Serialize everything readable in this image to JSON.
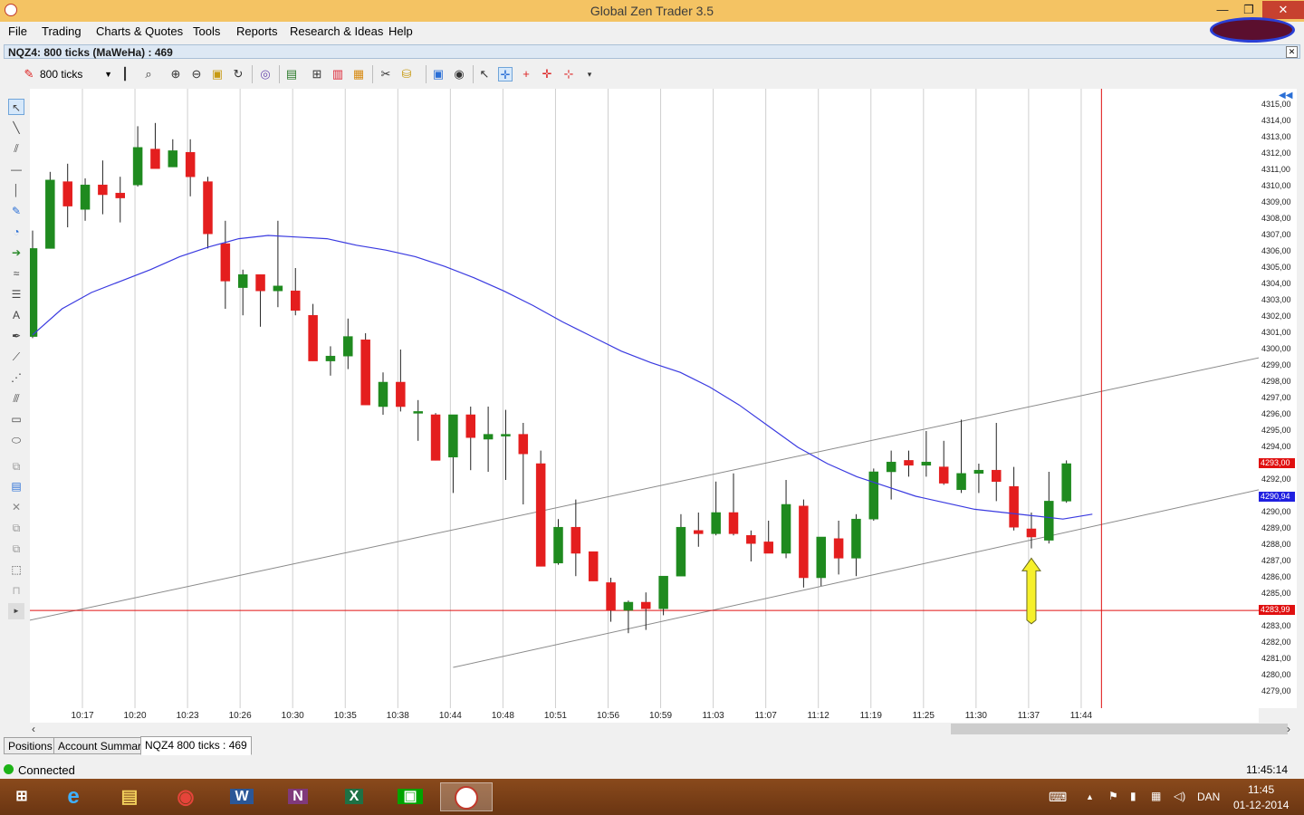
{
  "window": {
    "title": "Global Zen Trader 3.5",
    "controls": {
      "minimize": "—",
      "maximize": "❐",
      "close": "✕"
    }
  },
  "menu": [
    "File",
    "Trading",
    "Charts & Quotes",
    "Tools",
    "Reports",
    "Research & Ideas",
    "Help"
  ],
  "chart_window": {
    "title": "NQZ4: 800 ticks (MaWeHa) : 469"
  },
  "toolbar": {
    "ticks_value": "800 ticks"
  },
  "chart_data": {
    "type": "candlestick",
    "instrument": "NQZ4",
    "yaxis": {
      "min": 4278.0,
      "max": 4316.0,
      "tick_labels": [
        "4315,00",
        "4314,00",
        "4313,00",
        "4312,00",
        "4311,00",
        "4310,00",
        "4309,00",
        "4308,00",
        "4307,00",
        "4306,00",
        "4305,00",
        "4304,00",
        "4303,00",
        "4302,00",
        "4301,00",
        "4300,00",
        "4299,00",
        "4298,00",
        "4297,00",
        "4296,00",
        "4295,00",
        "4294,00",
        "4293,00",
        "4292,00",
        "4291,00",
        "4290,00",
        "4289,00",
        "4288,00",
        "4287,00",
        "4286,00",
        "4285,00",
        "4284,00",
        "4283,00",
        "4282,00",
        "4281,00",
        "4280,00",
        "4279,00"
      ],
      "price_badges": [
        {
          "label": "4293,00",
          "value": 4293.0,
          "color": "#e01010"
        },
        {
          "label": "4290,94",
          "value": 4290.94,
          "color": "#2020e0"
        },
        {
          "label": "4283,99",
          "value": 4283.99,
          "color": "#e01010"
        }
      ]
    },
    "xaxis": {
      "tick_labels": [
        "10:17",
        "10:20",
        "10:23",
        "10:26",
        "10:30",
        "10:35",
        "10:38",
        "10:44",
        "10:48",
        "10:51",
        "10:56",
        "10:59",
        "11:03",
        "11:07",
        "11:12",
        "11:19",
        "11:25",
        "11:30",
        "11:37",
        "11:44"
      ]
    },
    "candles": [
      {
        "o": 4300.8,
        "h": 4307.3,
        "l": 4300.7,
        "c": 4306.2
      },
      {
        "o": 4306.2,
        "h": 4310.9,
        "l": 4306.2,
        "c": 4310.4
      },
      {
        "o": 4310.3,
        "h": 4311.4,
        "l": 4307.5,
        "c": 4308.8
      },
      {
        "o": 4308.6,
        "h": 4310.5,
        "l": 4307.9,
        "c": 4310.1
      },
      {
        "o": 4310.1,
        "h": 4311.6,
        "l": 4308.3,
        "c": 4309.5
      },
      {
        "o": 4309.6,
        "h": 4310.6,
        "l": 4307.8,
        "c": 4309.3
      },
      {
        "o": 4310.1,
        "h": 4313.7,
        "l": 4310.0,
        "c": 4312.4
      },
      {
        "o": 4312.3,
        "h": 4313.9,
        "l": 4311.2,
        "c": 4311.1
      },
      {
        "o": 4311.2,
        "h": 4312.9,
        "l": 4311.2,
        "c": 4312.2
      },
      {
        "o": 4312.1,
        "h": 4312.9,
        "l": 4309.4,
        "c": 4310.6
      },
      {
        "o": 4310.3,
        "h": 4310.6,
        "l": 4306.2,
        "c": 4307.1
      },
      {
        "o": 4306.5,
        "h": 4307.9,
        "l": 4302.5,
        "c": 4304.2
      },
      {
        "o": 4303.8,
        "h": 4304.9,
        "l": 4302.1,
        "c": 4304.6
      },
      {
        "o": 4304.6,
        "h": 4304.6,
        "l": 4301.4,
        "c": 4303.6
      },
      {
        "o": 4303.6,
        "h": 4307.9,
        "l": 4302.6,
        "c": 4303.9
      },
      {
        "o": 4303.6,
        "h": 4305.0,
        "l": 4302.1,
        "c": 4302.4
      },
      {
        "o": 4302.1,
        "h": 4302.8,
        "l": 4299.3,
        "c": 4299.3
      },
      {
        "o": 4299.3,
        "h": 4300.2,
        "l": 4298.4,
        "c": 4299.6
      },
      {
        "o": 4299.6,
        "h": 4301.9,
        "l": 4298.8,
        "c": 4300.8
      },
      {
        "o": 4300.6,
        "h": 4301.0,
        "l": 4296.6,
        "c": 4296.6
      },
      {
        "o": 4296.5,
        "h": 4298.6,
        "l": 4296.0,
        "c": 4298.0
      },
      {
        "o": 4298.0,
        "h": 4300.0,
        "l": 4296.2,
        "c": 4296.5
      },
      {
        "o": 4296.2,
        "h": 4296.9,
        "l": 4294.4,
        "c": 4296.2
      },
      {
        "o": 4296.0,
        "h": 4296.1,
        "l": 4293.2,
        "c": 4293.2
      },
      {
        "o": 4293.4,
        "h": 4296.0,
        "l": 4291.2,
        "c": 4296.0
      },
      {
        "o": 4296.0,
        "h": 4296.5,
        "l": 4292.6,
        "c": 4294.6
      },
      {
        "o": 4294.5,
        "h": 4296.5,
        "l": 4292.5,
        "c": 4294.8
      },
      {
        "o": 4294.8,
        "h": 4296.3,
        "l": 4292.0,
        "c": 4294.8
      },
      {
        "o": 4294.8,
        "h": 4295.5,
        "l": 4290.5,
        "c": 4293.6
      },
      {
        "o": 4293.0,
        "h": 4293.8,
        "l": 4286.7,
        "c": 4286.7
      },
      {
        "o": 4286.9,
        "h": 4289.6,
        "l": 4286.8,
        "c": 4289.1
      },
      {
        "o": 4289.1,
        "h": 4290.8,
        "l": 4286.1,
        "c": 4287.5
      },
      {
        "o": 4287.6,
        "h": 4287.6,
        "l": 4285.8,
        "c": 4285.8
      },
      {
        "o": 4285.7,
        "h": 4286.0,
        "l": 4283.3,
        "c": 4284.0
      },
      {
        "o": 4284.0,
        "h": 4284.6,
        "l": 4282.6,
        "c": 4284.5
      },
      {
        "o": 4284.5,
        "h": 4285.1,
        "l": 4282.8,
        "c": 4284.1
      },
      {
        "o": 4284.1,
        "h": 4286.0,
        "l": 4283.7,
        "c": 4286.1
      },
      {
        "o": 4286.1,
        "h": 4289.9,
        "l": 4286.1,
        "c": 4289.1
      },
      {
        "o": 4288.9,
        "h": 4290.0,
        "l": 4287.9,
        "c": 4288.7
      },
      {
        "o": 4288.7,
        "h": 4291.9,
        "l": 4288.6,
        "c": 4290.0
      },
      {
        "o": 4290.0,
        "h": 4292.4,
        "l": 4288.6,
        "c": 4288.7
      },
      {
        "o": 4288.6,
        "h": 4288.9,
        "l": 4287.0,
        "c": 4288.1
      },
      {
        "o": 4288.2,
        "h": 4289.5,
        "l": 4287.6,
        "c": 4287.5
      },
      {
        "o": 4287.5,
        "h": 4292.0,
        "l": 4287.2,
        "c": 4290.5
      },
      {
        "o": 4290.4,
        "h": 4290.8,
        "l": 4285.4,
        "c": 4286.0
      },
      {
        "o": 4286.0,
        "h": 4288.5,
        "l": 4285.5,
        "c": 4288.5
      },
      {
        "o": 4288.4,
        "h": 4289.5,
        "l": 4286.2,
        "c": 4287.2
      },
      {
        "o": 4287.2,
        "h": 4289.9,
        "l": 4286.1,
        "c": 4289.6
      },
      {
        "o": 4289.6,
        "h": 4292.7,
        "l": 4289.5,
        "c": 4292.5
      },
      {
        "o": 4292.5,
        "h": 4293.8,
        "l": 4290.8,
        "c": 4293.1
      },
      {
        "o": 4293.2,
        "h": 4293.8,
        "l": 4292.2,
        "c": 4292.9
      },
      {
        "o": 4292.9,
        "h": 4295.0,
        "l": 4292.2,
        "c": 4293.1
      },
      {
        "o": 4292.8,
        "h": 4294.4,
        "l": 4291.7,
        "c": 4291.8
      },
      {
        "o": 4291.4,
        "h": 4295.7,
        "l": 4291.2,
        "c": 4292.4
      },
      {
        "o": 4292.4,
        "h": 4293.0,
        "l": 4291.2,
        "c": 4292.6
      },
      {
        "o": 4292.6,
        "h": 4295.5,
        "l": 4290.7,
        "c": 4291.9
      },
      {
        "o": 4291.6,
        "h": 4292.8,
        "l": 4288.9,
        "c": 4289.1
      },
      {
        "o": 4289.0,
        "h": 4290.0,
        "l": 4287.8,
        "c": 4288.5
      },
      {
        "o": 4288.3,
        "h": 4292.5,
        "l": 4288.1,
        "c": 4290.7
      },
      {
        "o": 4290.7,
        "h": 4293.2,
        "l": 4290.6,
        "c": 4293.0
      }
    ],
    "moving_average": [
      4300.9,
      4302.5,
      4303.5,
      4304.2,
      4304.9,
      4305.7,
      4306.3,
      4306.8,
      4307.0,
      4306.9,
      4306.8,
      4306.4,
      4306.1,
      4305.7,
      4305.1,
      4304.4,
      4303.6,
      4302.7,
      4301.7,
      4300.8,
      4299.9,
      4299.2,
      4298.6,
      4297.7,
      4296.6,
      4295.3,
      4294.0,
      4293.0,
      4292.2,
      4291.6,
      4291.0,
      4290.6,
      4290.2,
      4290.0,
      4289.8,
      4289.6,
      4289.9
    ],
    "trendlines": [
      {
        "from": {
          "index": -1.0,
          "price": 4283.2
        },
        "to": {
          "index": 70.0,
          "price": 4299.5
        }
      },
      {
        "from": {
          "index": 24.0,
          "price": 4280.5
        },
        "to": {
          "index": 70.0,
          "price": 4291.4
        }
      }
    ],
    "hline": {
      "price": 4283.99,
      "color": "#e01010"
    },
    "vline": {
      "index": 61.0,
      "color": "#e01010"
    },
    "annotation_arrow": {
      "index": 57.0,
      "price_top": 4287.2,
      "price_bottom": 4283.4,
      "color": "#f6f02a"
    },
    "colors": {
      "up": "#1f8a1f",
      "down": "#e41e1e",
      "ma": "#3a3ae0",
      "trend": "#8a8a8a"
    }
  },
  "tabs": [
    "Positions",
    "Account Summary",
    "NQZ4 800 ticks : 469"
  ],
  "status": {
    "text": "Connected",
    "time": "11:45:14"
  },
  "taskbar": {
    "apps": [
      "windows-start",
      "internet-explorer",
      "file-explorer",
      "chrome",
      "word",
      "onenote",
      "excel",
      "store",
      "global-zen"
    ],
    "app_letters": {
      "word": "W",
      "onenote": "N",
      "excel": "X"
    },
    "language": "DAN",
    "clock_time": "11:45",
    "clock_date": "01-12-2014"
  }
}
